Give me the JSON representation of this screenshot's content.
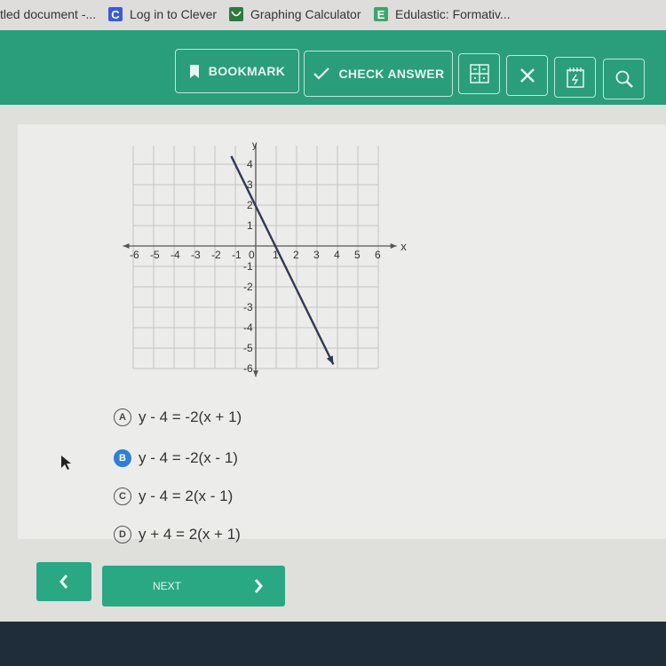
{
  "bookmarks": [
    {
      "label": "tled document -...",
      "icon": "docs-icon",
      "color": ""
    },
    {
      "label": "Log in to Clever",
      "icon": "clever-icon",
      "glyph": "C",
      "color": "#3b5bd6"
    },
    {
      "label": "Graphing Calculator",
      "icon": "desmos-icon",
      "glyph": "",
      "color": "#2d7a3e"
    },
    {
      "label": "Edulastic: Formativ...",
      "icon": "edulastic-icon",
      "glyph": "E",
      "color": "#3aa86b"
    }
  ],
  "toolbar": {
    "bookmark_label": "BOOKMARK",
    "check_answer_label": "CHECK ANSWER",
    "icons": [
      "calculator-icon",
      "close-icon",
      "scratchpad-icon",
      "magnifier-icon"
    ]
  },
  "chart_data": {
    "type": "line",
    "title": "",
    "xlabel": "x",
    "ylabel": "y",
    "xlim": [
      -6,
      6
    ],
    "ylim": [
      -6,
      4
    ],
    "x_ticks": [
      "-6",
      "-5",
      "-4",
      "-3",
      "-2",
      "-1",
      "0",
      "1",
      "2",
      "3",
      "4",
      "5",
      "6"
    ],
    "y_ticks": [
      "4",
      "3",
      "2",
      "1",
      "-1",
      "-2",
      "-3",
      "-4",
      "-5",
      "-6"
    ],
    "grid": true,
    "series": [
      {
        "name": "line",
        "points": [
          [
            -1.2,
            4.4
          ],
          [
            3.8,
            -5.8
          ]
        ],
        "slope": -2,
        "y_intercept": 2,
        "x_intercept": 1,
        "arrow_end": true
      }
    ]
  },
  "question": {
    "choices": [
      {
        "letter": "A",
        "text": "y - 4 = -2(x + 1)",
        "selected": false
      },
      {
        "letter": "B",
        "text": "y - 4 = -2(x - 1)",
        "selected": true
      },
      {
        "letter": "C",
        "text": "y - 4 = 2(x - 1)",
        "selected": false
      },
      {
        "letter": "D",
        "text": "y + 4 = 2(x + 1)",
        "selected": false
      }
    ]
  },
  "nav": {
    "prev_icon": "chevron-left-icon",
    "next_label": "NEXT",
    "next_icon": "chevron-right-icon"
  },
  "colors": {
    "toolbar_green": "#2a9d7a",
    "nav_green": "#2aa883",
    "selected_blue": "#2f7fd6",
    "line_color": "#2e3a55"
  }
}
